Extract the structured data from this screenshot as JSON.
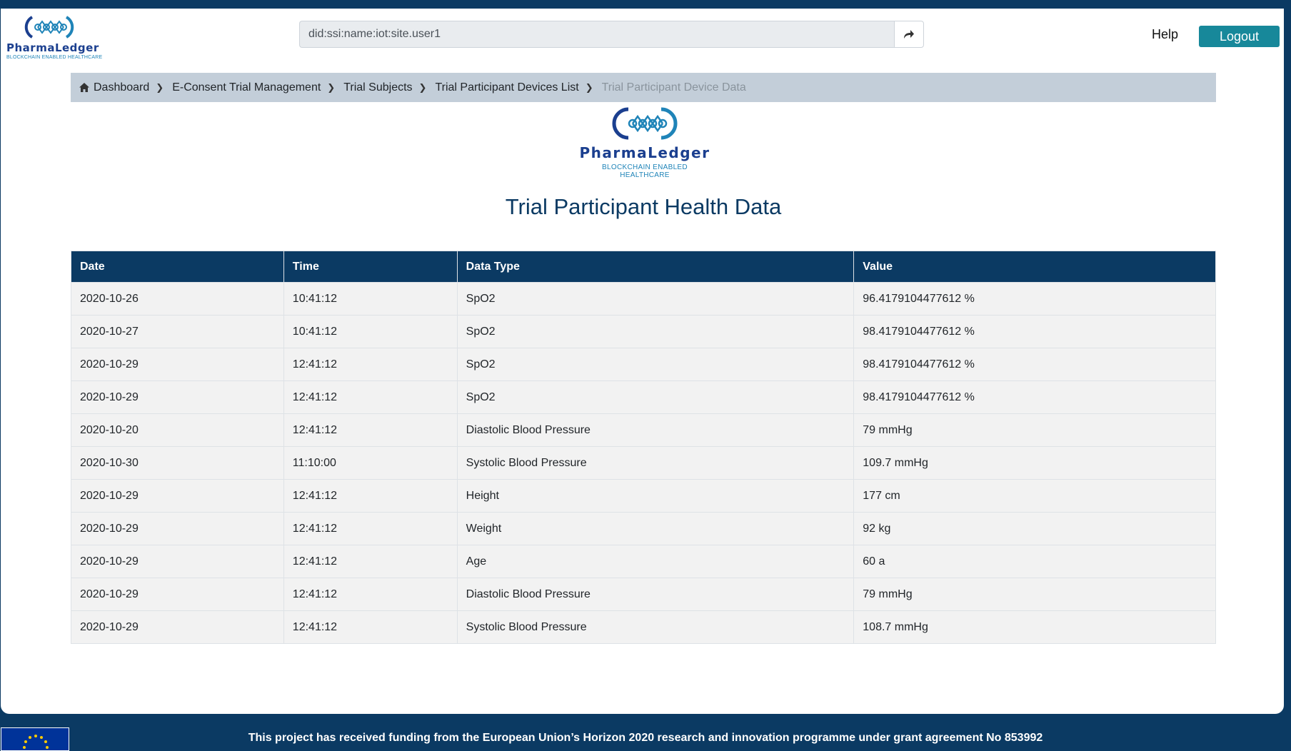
{
  "header": {
    "logo_brand": "PharmaLedger",
    "logo_tagline": "BLOCKCHAIN ENABLED HEALTHCARE",
    "did_value": "did:ssi:name:iot:site.user1",
    "help_label": "Help",
    "logout_label": "Logout"
  },
  "breadcrumb": {
    "items": [
      {
        "label": "Dashboard"
      },
      {
        "label": "E-Consent Trial Management"
      },
      {
        "label": "Trial Subjects"
      },
      {
        "label": "Trial Participant Devices List"
      },
      {
        "label": "Trial Participant Device Data"
      }
    ]
  },
  "main": {
    "logo_brand": "PharmaLedger",
    "logo_tagline": "BLOCKCHAIN ENABLED HEALTHCARE",
    "title": "Trial Participant Health Data",
    "table": {
      "columns": [
        "Date",
        "Time",
        "Data Type",
        "Value"
      ],
      "rows": [
        [
          "2020-10-26",
          "10:41:12",
          "SpO2",
          "96.4179104477612 %"
        ],
        [
          "2020-10-27",
          "10:41:12",
          "SpO2",
          "98.4179104477612 %"
        ],
        [
          "2020-10-29",
          "12:41:12",
          "SpO2",
          "98.4179104477612 %"
        ],
        [
          "2020-10-29",
          "12:41:12",
          "SpO2",
          "98.4179104477612 %"
        ],
        [
          "2020-10-20",
          "12:41:12",
          "Diastolic Blood Pressure",
          "79 mmHg"
        ],
        [
          "2020-10-30",
          "11:10:00",
          "Systolic Blood Pressure",
          "109.7 mmHg"
        ],
        [
          "2020-10-29",
          "12:41:12",
          "Height",
          "177 cm"
        ],
        [
          "2020-10-29",
          "12:41:12",
          "Weight",
          "92 kg"
        ],
        [
          "2020-10-29",
          "12:41:12",
          "Age",
          "60 a"
        ],
        [
          "2020-10-29",
          "12:41:12",
          "Diastolic Blood Pressure",
          "79 mmHg"
        ],
        [
          "2020-10-29",
          "12:41:12",
          "Systolic Blood Pressure",
          "108.7 mmHg"
        ]
      ]
    }
  },
  "footer": {
    "funding_text": "This project has received funding from the European Union’s Horizon 2020 research and innovation programme under grant agreement No 853992"
  },
  "colors": {
    "page_background": "#0b3a63",
    "table_header": "#0b3a63",
    "logout_button": "#17889a",
    "breadcrumb_background": "#c3ced9",
    "title": "#0b3a63"
  },
  "icons": {
    "share": "share-arrow-icon",
    "home": "home-icon",
    "breadcrumb_separator": "chevron-right-icon",
    "flag": "eu-flag-icon"
  }
}
